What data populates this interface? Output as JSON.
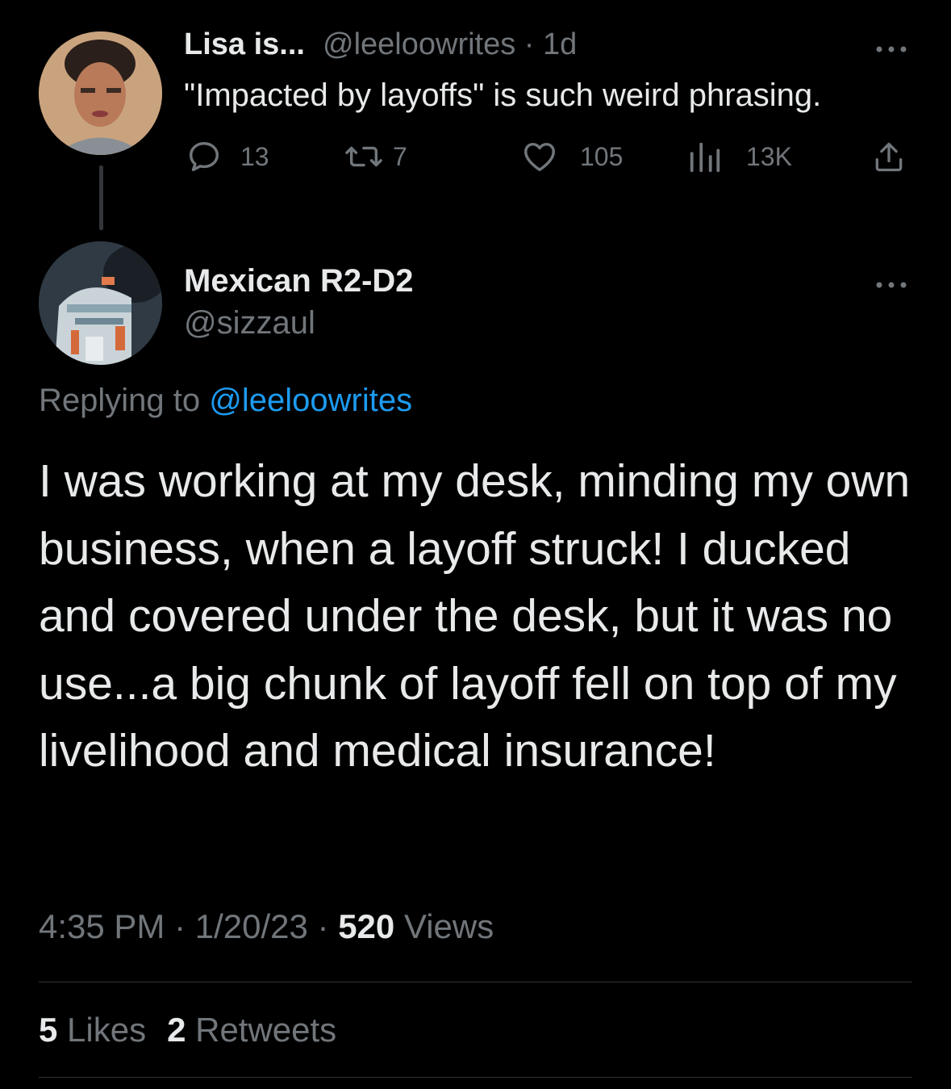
{
  "parent_tweet": {
    "display_name": "Lisa is...",
    "handle_time": "@leeloowrites · 1d",
    "text": "\"Impacted by layoffs\" is such weird phrasing.",
    "more_icon": "more-horizontal-icon",
    "actions": {
      "replies": "13",
      "retweets": "7",
      "likes": "105",
      "views": "13K"
    }
  },
  "main_tweet": {
    "display_name": "Mexican R2-D2",
    "handle": "@sizzaul",
    "more_icon": "more-horizontal-icon",
    "replying_prefix": "Replying to",
    "replying_handle": "@leeloowrites",
    "text": "I was working at my desk, minding my own business, when a layoff struck! I ducked and covered under the desk, but it was no use...a big chunk of layoff fell on top of my livelihood and medical insurance!",
    "timestamp": "4:35 PM · 1/20/23 · ",
    "views_count": "520",
    "views_label": " Views",
    "likes_count": "5",
    "likes_label": " Likes",
    "retweets_count": "2",
    "retweets_label": " Retweets"
  },
  "colors": {
    "background": "#000000",
    "primary_text": "#e7e9ea",
    "secondary_text": "#71767b",
    "link": "#1d9bf0",
    "divider": "#2f3336"
  }
}
